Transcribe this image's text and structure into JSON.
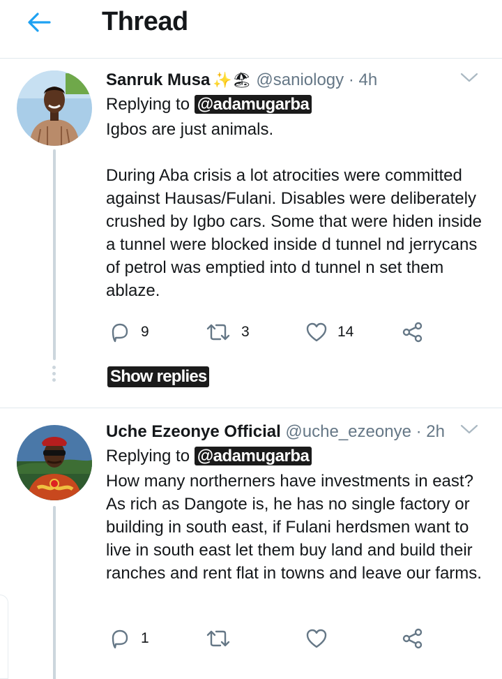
{
  "header": {
    "title": "Thread",
    "back_icon": "arrow-left-icon",
    "accent": "#1da1f2"
  },
  "tweets": [
    {
      "name": "Sanruk Musa",
      "emojis": "✨🏖",
      "handle": "@saniology",
      "separator": "·",
      "time": "4h",
      "replying_prefix": "Replying to",
      "replying_to": "@adamugarba",
      "text": "Igbos are just animals.\n\nDuring Aba crisis a lot atrocities were committed against Hausas/Fulani. Disables were deliberately crushed by Igbo cars. Some that were hiden inside a tunnel were blocked inside d tunnel nd jerrycans of petrol was emptied into d tunnel n set them ablaze.",
      "replies": "9",
      "retweets": "3",
      "likes": "14",
      "show_replies": "Show replies"
    },
    {
      "name": "Uche Ezeonye Official",
      "handle": "@uche_ezeonye",
      "separator": "·",
      "time": "2h",
      "replying_prefix": "Replying to",
      "replying_to": "@adamugarba",
      "text": "How many northerners have investments in east?  As rich as Dangote is, he has no single factory or building in south east, if Fulani herdsmen want to live in south east let them buy land and build their ranches and rent flat in towns and leave our farms.",
      "replies": "1",
      "retweets": "",
      "likes": ""
    }
  ]
}
